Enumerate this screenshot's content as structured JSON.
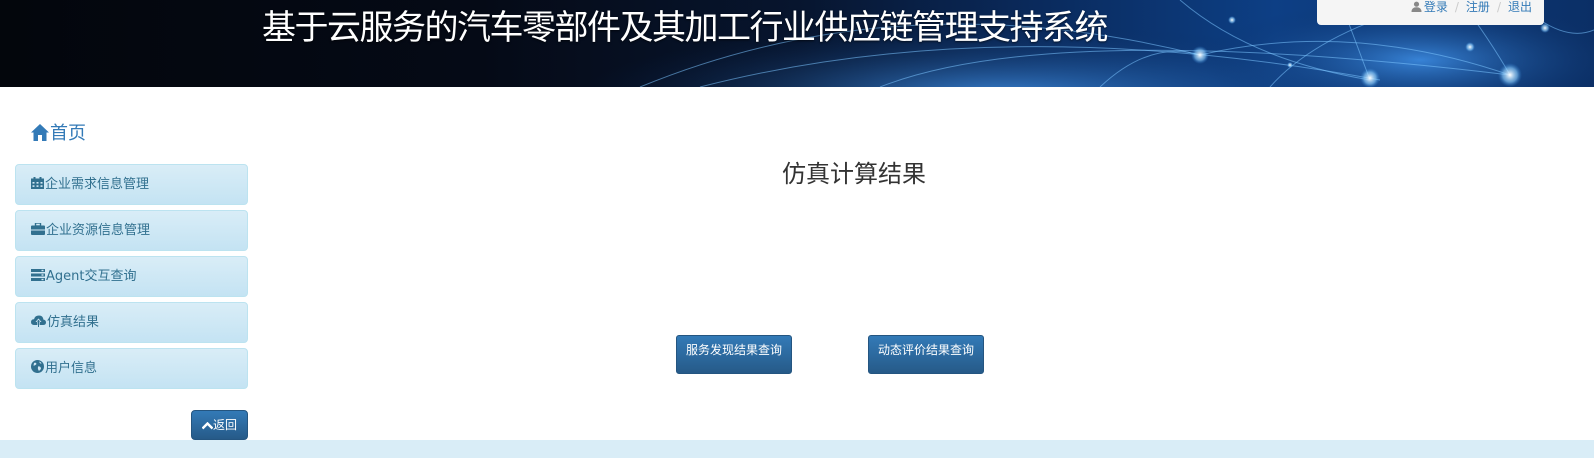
{
  "header": {
    "title": "基于云服务的汽车零部件及其加工行业供应链管理支持系统",
    "account": {
      "login_label": "登录",
      "register_label": "注册",
      "logout_label": "退出",
      "separator": "/"
    }
  },
  "sidebar": {
    "home_label": "首页",
    "items": [
      {
        "icon": "calendar-icon",
        "label": "企业需求信息管理"
      },
      {
        "icon": "briefcase-icon",
        "label": "企业资源信息管理"
      },
      {
        "icon": "list-icon",
        "label": "Agent交互查询"
      },
      {
        "icon": "cloud-upload-icon",
        "label": "仿真结果"
      },
      {
        "icon": "globe-icon",
        "label": "用户信息"
      }
    ],
    "back_label": "返回"
  },
  "main": {
    "title": "仿真计算结果",
    "buttons": [
      {
        "label": "服务发现结果查询"
      },
      {
        "label": "动态评价结果查询"
      }
    ]
  },
  "colors": {
    "link": "#337ab7",
    "sidebar_bg": "#d9edf7",
    "sidebar_text": "#31708f",
    "primary_button": "#337ab7",
    "footer_strip": "#d9edf7"
  }
}
